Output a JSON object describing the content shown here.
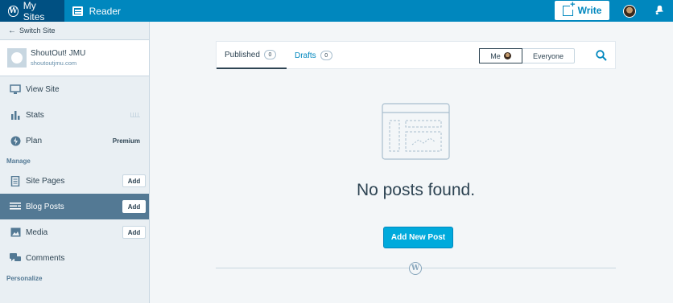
{
  "topbar": {
    "my_sites": "My Sites",
    "reader": "Reader",
    "write": "Write",
    "wp_glyph": "W"
  },
  "sidebar": {
    "switch_site": "Switch Site",
    "site": {
      "name": "ShoutOut! JMU",
      "url": "shoutoutjmu.com"
    },
    "items": [
      {
        "label": "View Site",
        "icon": "monitor-icon"
      },
      {
        "label": "Stats",
        "icon": "bar-chart-icon"
      },
      {
        "label": "Plan",
        "icon": "plan-bolt-icon",
        "badge": "Premium"
      }
    ],
    "manage_label": "Manage",
    "manage_items": [
      {
        "label": "Site Pages",
        "icon": "page-icon",
        "action": "Add"
      },
      {
        "label": "Blog Posts",
        "icon": "posts-icon",
        "action": "Add",
        "active": true
      },
      {
        "label": "Media",
        "icon": "image-icon",
        "action": "Add"
      },
      {
        "label": "Comments",
        "icon": "comments-icon"
      }
    ],
    "personalize_label": "Personalize"
  },
  "main": {
    "tabs": [
      {
        "label": "Published",
        "count": "0",
        "selected": true
      },
      {
        "label": "Drafts",
        "count": "0",
        "selected": false
      }
    ],
    "author_filter": {
      "me": "Me",
      "everyone": "Everyone",
      "selected": "Me"
    },
    "empty_title": "No posts found.",
    "add_new_post": "Add New Post"
  },
  "colors": {
    "masterbar": "#0087be",
    "masterbar_active": "#005082",
    "sidebar_bg": "#e9eff3",
    "sidebar_active": "#537994",
    "primary_button": "#00aadc",
    "text": "#2e4453"
  }
}
